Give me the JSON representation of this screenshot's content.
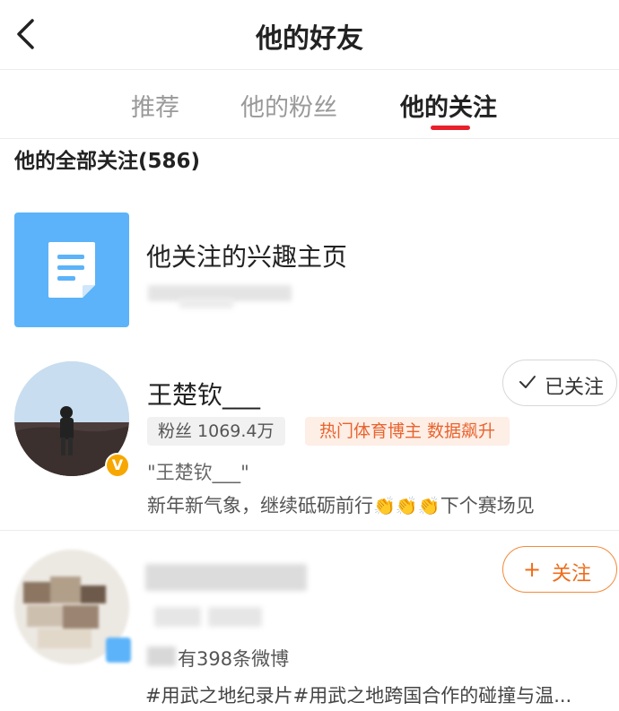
{
  "header": {
    "title": "他的好友"
  },
  "tabs": [
    {
      "label": "推荐",
      "active": false
    },
    {
      "label": "他的粉丝",
      "active": false
    },
    {
      "label": "他的关注",
      "active": true
    }
  ],
  "section": {
    "title": "他的全部关注(586)"
  },
  "interest_page": {
    "title": "他关注的兴趣主页"
  },
  "users": [
    {
      "name": "王楚钦___",
      "badge": "V",
      "follow_button": "已关注",
      "fans_tag": "粉丝 1069.4万",
      "hot_tag": "热门体育博主 数据飙升",
      "quote": "\"王楚钦___\"",
      "bio_text": "新年新气象，继续砥砺前行",
      "bio_suffix": "下个赛场见"
    },
    {
      "follow_button": "关注",
      "follow_plus": "+",
      "posts": "有398条微博",
      "tags_line": "#用武之地纪录片#用武之地跨国合作的碰撞与温..."
    }
  ],
  "colors": {
    "accent_red": "#e8202b",
    "follow_orange": "#f06c1a",
    "doc_blue": "#5cb3f9",
    "vip_gold": "#f7a700"
  },
  "icons": [
    "back-arrow-icon",
    "document-icon",
    "check-icon",
    "plus-icon",
    "clap-emoji-icon"
  ]
}
